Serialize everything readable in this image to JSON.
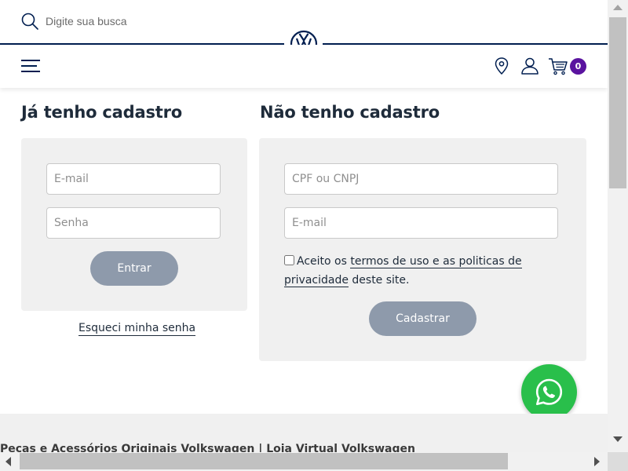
{
  "search": {
    "placeholder": "Digite sua busca"
  },
  "header": {
    "logo": "vw-logo-icon",
    "cart_count": "0"
  },
  "login": {
    "heading": "Já tenho cadastro",
    "email_placeholder": "E-mail",
    "password_placeholder": "Senha",
    "submit_label": "Entrar",
    "forgot_label": "Esqueci minha senha"
  },
  "register": {
    "heading": "Não tenho cadastro",
    "doc_placeholder": "CPF ou CNPJ",
    "email_placeholder": "E-mail",
    "terms_prefix": "Aceito os ",
    "terms_link": "termos de uso e as politicas de",
    "privacy_link": "privacidade",
    "terms_suffix": " deste site.",
    "submit_label": "Cadastrar"
  },
  "footer": {
    "title": "Peças e Acessórios Originais Volkswagen | Loja Virtual Volkswagen"
  },
  "colors": {
    "navy": "#001e50",
    "button": "#8e9aab",
    "panel": "#f0f0f0",
    "badge": "#5a139f",
    "whatsapp": "#29bf4b"
  }
}
